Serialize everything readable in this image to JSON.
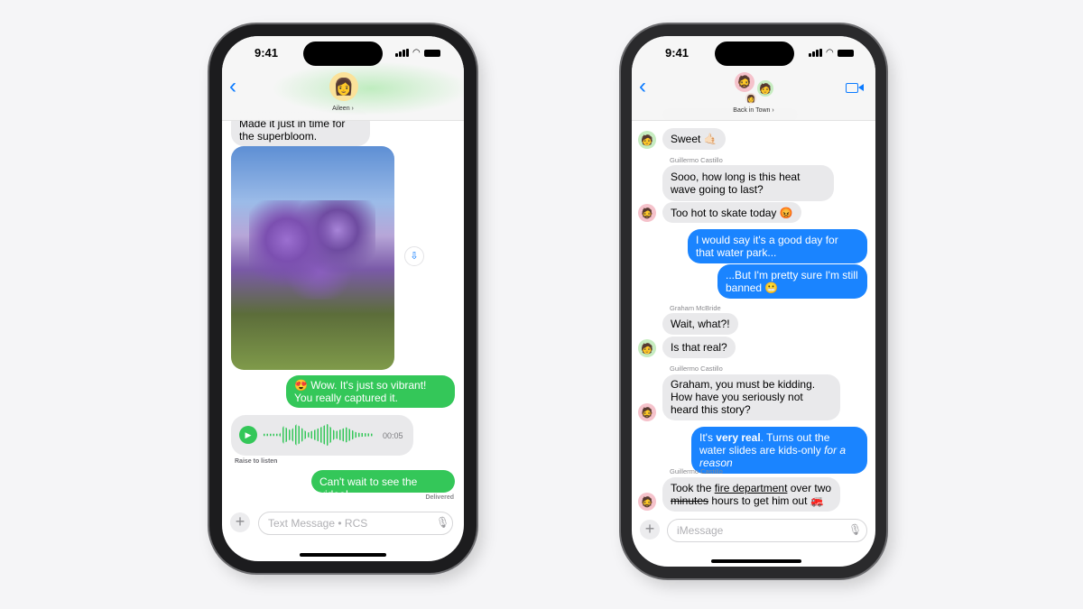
{
  "left_phone": {
    "status_time": "9:41",
    "contact_name": "Aileen",
    "contact_avatar": "memoji-woman",
    "messages": [
      {
        "type": "incoming",
        "text": "Made it just in time for the superbloom."
      },
      {
        "type": "image",
        "alt": "lavender-photo"
      },
      {
        "type": "outgoing",
        "text": "😍 Wow. It's just so vibrant! You really captured it."
      },
      {
        "type": "audio",
        "duration": "00:05",
        "note": "Raise to listen"
      },
      {
        "type": "outgoing",
        "text": "Can't wait to see the video!"
      }
    ],
    "delivery_status": "Delivered",
    "input_placeholder": "Text Message • RCS",
    "colors": {
      "outgoing": "#34c759",
      "accent": "#0a7aff"
    }
  },
  "right_phone": {
    "status_time": "9:41",
    "group_name": "Back in Town",
    "messages": [
      {
        "type": "incoming",
        "avatar": "green",
        "text": "Sweet 🤙🏻"
      },
      {
        "type": "sender",
        "text": "Guillermo Castillo"
      },
      {
        "type": "incoming",
        "text": "Sooo, how long is this heat wave going to last?"
      },
      {
        "type": "incoming",
        "avatar": "pink",
        "text": "Too hot to skate today 😡"
      },
      {
        "type": "outgoing",
        "text": "I would say it's a good day for that water park..."
      },
      {
        "type": "outgoing",
        "text": "...But I'm pretty sure I'm still banned 😬"
      },
      {
        "type": "sender",
        "text": "Graham McBride"
      },
      {
        "type": "incoming",
        "text": "Wait, what?!"
      },
      {
        "type": "incoming",
        "avatar": "green",
        "text": "Is that real?"
      },
      {
        "type": "sender",
        "text": "Guillermo Castillo"
      },
      {
        "type": "incoming",
        "avatar": "pink",
        "text": "Graham, you must be kidding. How have you seriously not heard this story?"
      },
      {
        "type": "outgoing",
        "parts": [
          "It's ",
          "very real",
          ". Turns out the water slides are kids-only ",
          "for a reason"
        ]
      },
      {
        "type": "sender",
        "text": "Guillermo Castillo"
      },
      {
        "type": "incoming",
        "avatar": "pink",
        "parts": [
          "Took the ",
          "fire department",
          " over two ",
          "minutes",
          " hours to get him out 🚒"
        ]
      }
    ],
    "input_placeholder": "iMessage",
    "colors": {
      "outgoing": "#1a84ff",
      "accent": "#0a7aff"
    }
  }
}
